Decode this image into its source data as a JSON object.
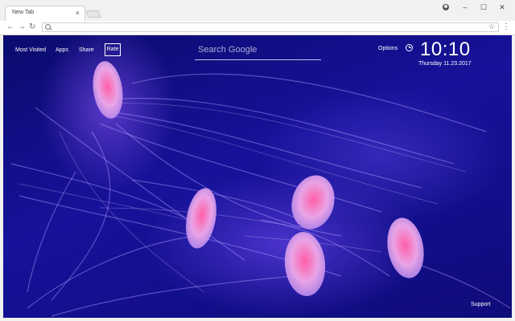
{
  "browser": {
    "tab_title": "New Tab",
    "tab_close": "×",
    "omnibox_placeholder": "",
    "window_controls": {
      "minimize": "–",
      "maximize": "☐",
      "close": "✕"
    }
  },
  "newtab": {
    "nav": {
      "most_visited": "Most Visited",
      "apps": "Apps",
      "share": "Share",
      "rate": "Rate"
    },
    "search_placeholder": "Search Google",
    "options": "Options",
    "clock": {
      "time": "10:10",
      "date": "Thursday  11.23.2017"
    },
    "support": "Support"
  }
}
